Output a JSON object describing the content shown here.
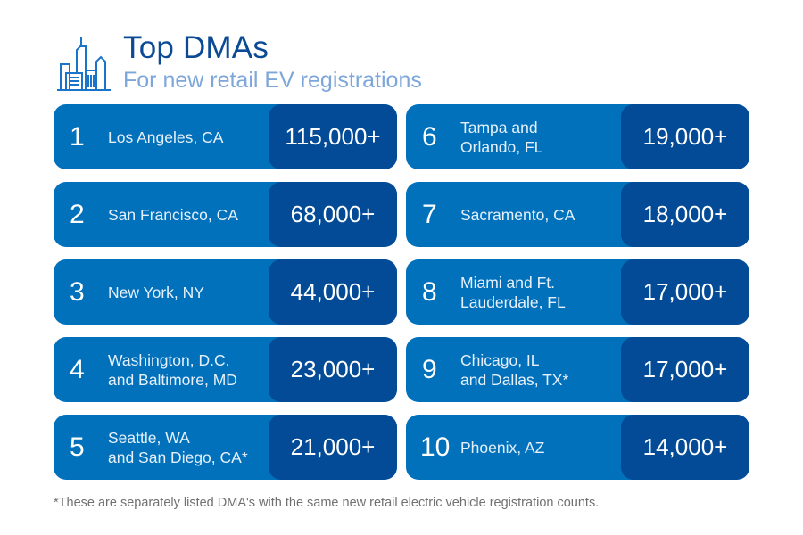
{
  "header": {
    "icon": "city-skyline-icon",
    "title": "Top DMAs",
    "subtitle": "For new retail EV registrations"
  },
  "colors": {
    "card": "#0171BC",
    "value_pill": "#034B97",
    "title": "#0B4A94",
    "subtitle": "#7DA6DA",
    "footnote": "#707070"
  },
  "dmas": [
    {
      "rank": "1",
      "name_line1": "Los Angeles, CA",
      "name_line2": "",
      "registrations": "115,000+"
    },
    {
      "rank": "2",
      "name_line1": "San Francisco, CA",
      "name_line2": "",
      "registrations": "68,000+"
    },
    {
      "rank": "3",
      "name_line1": "New York, NY",
      "name_line2": "",
      "registrations": "44,000+"
    },
    {
      "rank": "4",
      "name_line1": "Washington, D.C.",
      "name_line2": "and Baltimore, MD",
      "registrations": "23,000+"
    },
    {
      "rank": "5",
      "name_line1": "Seattle, WA",
      "name_line2": "and San Diego, CA*",
      "registrations": "21,000+"
    },
    {
      "rank": "6",
      "name_line1": "Tampa and",
      "name_line2": "Orlando, FL",
      "registrations": "19,000+"
    },
    {
      "rank": "7",
      "name_line1": "Sacramento, CA",
      "name_line2": "",
      "registrations": "18,000+"
    },
    {
      "rank": "8",
      "name_line1": "Miami and Ft.",
      "name_line2": "Lauderdale, FL",
      "registrations": "17,000+"
    },
    {
      "rank": "9",
      "name_line1": "Chicago, IL",
      "name_line2": "and Dallas, TX*",
      "registrations": "17,000+"
    },
    {
      "rank": "10",
      "name_line1": "Phoenix, AZ",
      "name_line2": "",
      "registrations": "14,000+"
    }
  ],
  "footnote": "*These are separately listed DMA's with the same new retail electric vehicle registration counts."
}
